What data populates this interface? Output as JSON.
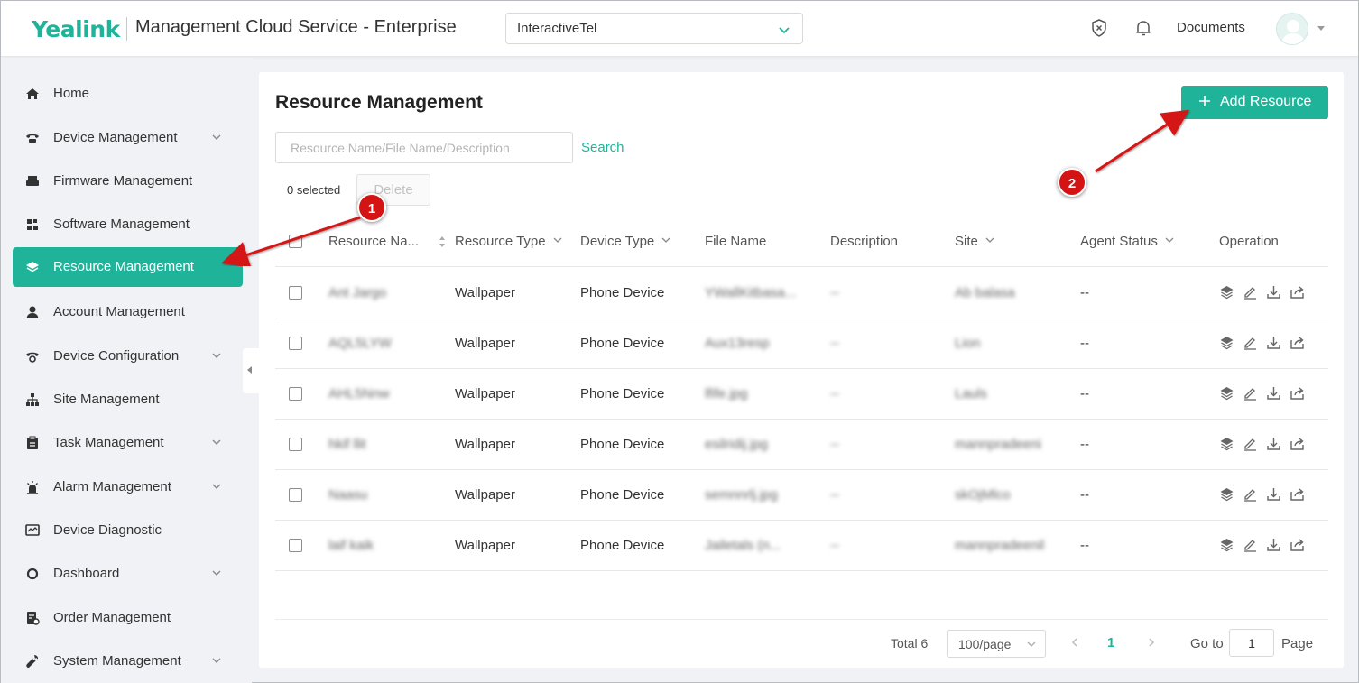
{
  "header": {
    "logo": "Yealink",
    "app_title": "Management Cloud Service - Enterprise",
    "org_select_value": "InteractiveTel",
    "documents_label": "Documents"
  },
  "sidebar": {
    "items": [
      {
        "label": "Home",
        "icon": "home-icon",
        "expandable": false
      },
      {
        "label": "Device Management",
        "icon": "phone-icon",
        "expandable": true
      },
      {
        "label": "Firmware Management",
        "icon": "printer-icon",
        "expandable": false
      },
      {
        "label": "Software Management",
        "icon": "apps-icon",
        "expandable": false
      },
      {
        "label": "Resource Management",
        "icon": "layers-icon",
        "expandable": false,
        "active": true
      },
      {
        "label": "Account Management",
        "icon": "user-icon",
        "expandable": false
      },
      {
        "label": "Device Configuration",
        "icon": "phone-gear-icon",
        "expandable": true
      },
      {
        "label": "Site Management",
        "icon": "sitemap-icon",
        "expandable": false
      },
      {
        "label": "Task Management",
        "icon": "clipboard-icon",
        "expandable": true
      },
      {
        "label": "Alarm Management",
        "icon": "alarm-icon",
        "expandable": true
      },
      {
        "label": "Device Diagnostic",
        "icon": "monitor-icon",
        "expandable": false
      },
      {
        "label": "Dashboard",
        "icon": "dashboard-icon",
        "expandable": true
      },
      {
        "label": "Order Management",
        "icon": "order-icon",
        "expandable": false
      },
      {
        "label": "System Management",
        "icon": "wrench-icon",
        "expandable": true
      }
    ]
  },
  "main": {
    "page_title": "Resource Management",
    "add_button_label": "Add Resource",
    "search_placeholder": "Resource Name/File Name/Description",
    "search_label": "Search",
    "selected_text": "0 selected",
    "delete_label": "Delete",
    "columns": [
      "Resource Na...",
      "Resource Type",
      "Device Type",
      "File Name",
      "Description",
      "Site",
      "Agent Status",
      "Operation"
    ],
    "rows": [
      {
        "name": "Ant Jargo",
        "type": "Wallpaper",
        "device": "Phone Device",
        "file": "YWallKitbasa...",
        "desc": "--",
        "site": "Ab balasa",
        "status": "--"
      },
      {
        "name": "AQL5LYW",
        "type": "Wallpaper",
        "device": "Phone Device",
        "file": "Aux13resp",
        "desc": "--",
        "site": "Lion",
        "status": "--"
      },
      {
        "name": "AHL5Nnw",
        "type": "Wallpaper",
        "device": "Phone Device",
        "file": "lfife.jpg",
        "desc": "--",
        "site": "Lauls",
        "status": "--"
      },
      {
        "name": "hkif llit",
        "type": "Wallpaper",
        "device": "Phone Device",
        "file": "esilridij.jpg",
        "desc": "--",
        "site": "mannpradeeni",
        "status": "--"
      },
      {
        "name": "Naasu",
        "type": "Wallpaper",
        "device": "Phone Device",
        "file": "semnnrlj.jpg",
        "desc": "--",
        "site": "skOjMlco",
        "status": "--"
      },
      {
        "name": "laif kaik",
        "type": "Wallpaper",
        "device": "Phone Device",
        "file": "Jailetals (n...",
        "desc": "--",
        "site": "mannpradeenil",
        "status": "--"
      }
    ],
    "pagination": {
      "total_text": "Total 6",
      "page_size": "100/page",
      "current_page": "1",
      "goto_label": "Go to",
      "goto_value": "1",
      "page_label": "Page"
    }
  },
  "annotations": {
    "badge_1": "1",
    "badge_2": "2",
    "arrow_color": "#d41414"
  },
  "colors": {
    "accent": "#1fb49a",
    "annotation": "#d41414"
  }
}
